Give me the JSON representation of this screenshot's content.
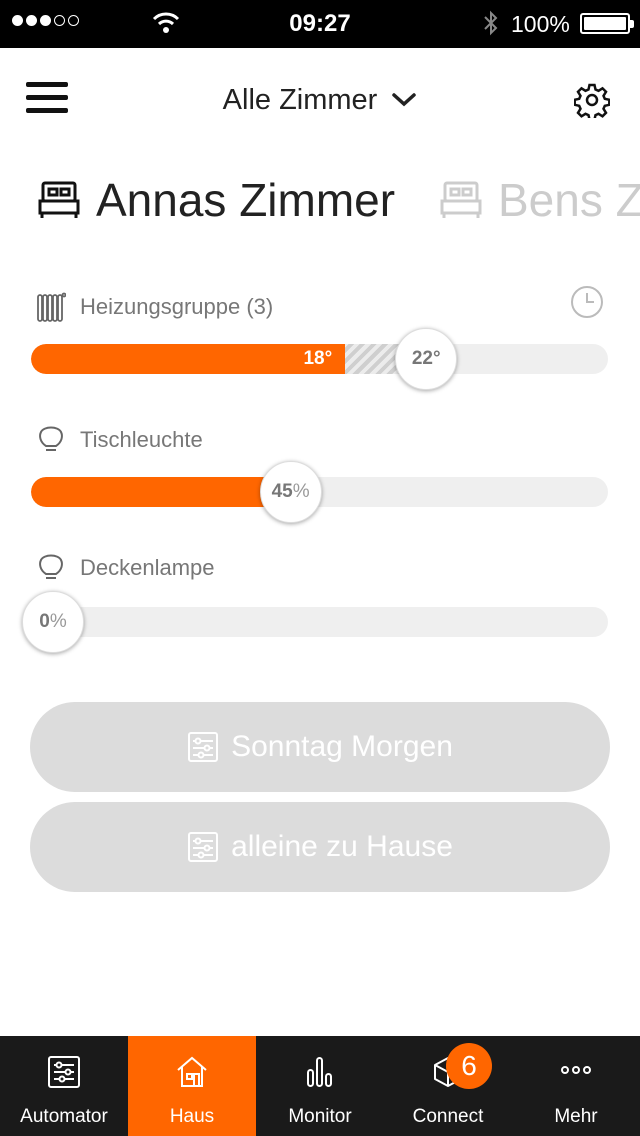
{
  "status_bar": {
    "time": "09:27",
    "battery": "100%",
    "signal_dots_filled": 3,
    "signal_dots_total": 5
  },
  "header": {
    "room_selector": "Alle Zimmer"
  },
  "rooms": [
    {
      "name": "Annas Zimmer",
      "icon": "bed-icon",
      "active": true
    },
    {
      "name": "Bens Z",
      "icon": "bed-icon",
      "active": false
    }
  ],
  "devices": {
    "heating": {
      "name": "Heizungsgruppe (3)",
      "icon": "radiator-icon",
      "current": "18°",
      "target": "22°",
      "current_fraction": 0.545,
      "target_fraction": 0.685
    },
    "desk_lamp": {
      "name": "Tischleuchte",
      "icon": "bulb-icon",
      "value": "45",
      "unit": "%",
      "level_percent": 45
    },
    "ceiling_lamp": {
      "name": "Deckenlampe",
      "icon": "bulb-icon",
      "value": "0",
      "unit": "%",
      "level_percent": 0
    }
  },
  "scenes": [
    {
      "label": "Sonntag Morgen",
      "icon": "scene-sliders-icon"
    },
    {
      "label": "alleine zu Hause",
      "icon": "scene-sliders-icon"
    }
  ],
  "tabbar": {
    "tabs": [
      {
        "label": "Automator",
        "icon": "automator-icon"
      },
      {
        "label": "Haus",
        "icon": "house-icon",
        "active": true
      },
      {
        "label": "Monitor",
        "icon": "bars-icon"
      },
      {
        "label": "Connect",
        "icon": "cube-icon",
        "badge": "6"
      },
      {
        "label": "Mehr",
        "icon": "more-dots-icon"
      }
    ]
  },
  "colors": {
    "accent": "#ff6600",
    "tabbar_bg": "#1a1a1a",
    "scene_bg": "#dcdcdc",
    "track_bg": "#efefef"
  }
}
